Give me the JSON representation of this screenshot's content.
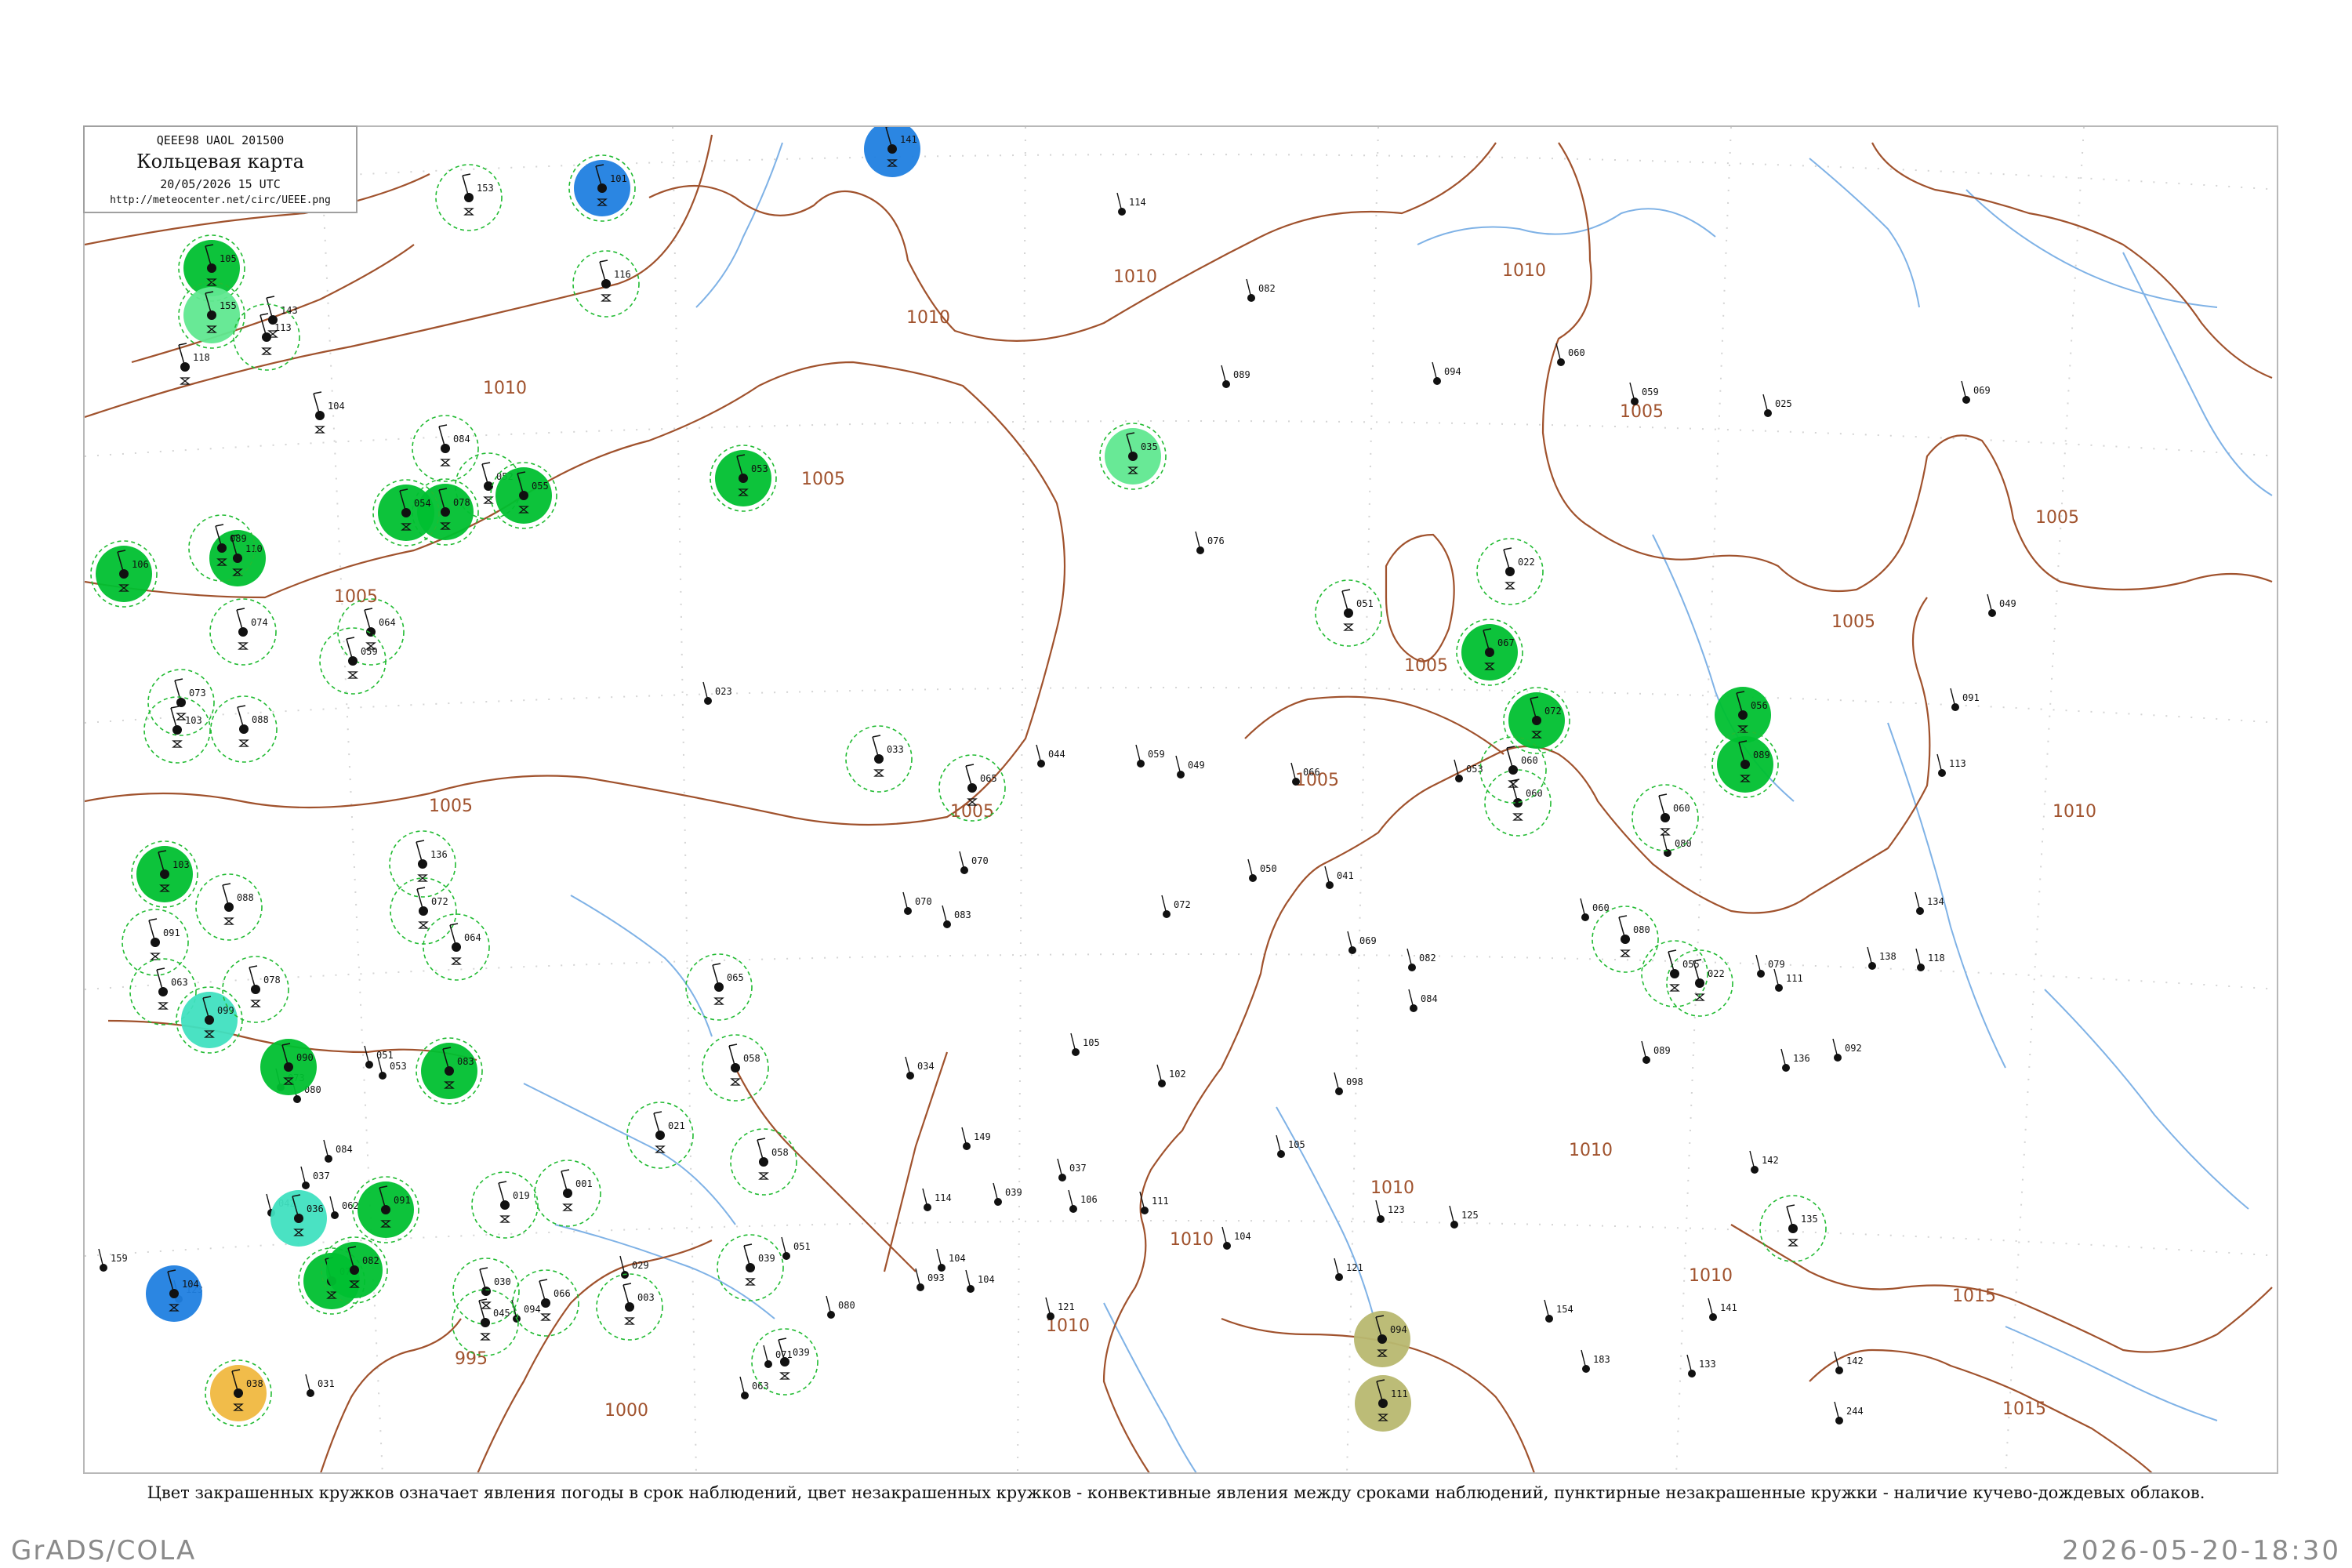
{
  "legend": {
    "code": "QEEE98  UAOL  201500",
    "title": "Кольцевая карта",
    "date": "20/05/2026 15 UTC",
    "url": "http://meteocenter.net/circ/UEEE.png"
  },
  "caption": "Цвет закрашенных кружков означает явления погоды в срок наблюдений, цвет незакрашенных кружков - конвективные явления между сроками наблюдений, пунктирные незакрашенные кружки - наличие кучево-дождевых облаков.",
  "footer": {
    "left": "GrADS/COLA",
    "right": "2026-05-20-18:30"
  },
  "colors": {
    "isobar": "#a0522d",
    "water": "#7fb2e6",
    "rain": "#00c030",
    "showers": "#2080e0",
    "drizzle": "#60e890",
    "fog": "#40e0c0",
    "haze": "#b8b870",
    "dust": "#f0b840",
    "cb_ring": "#22bb33"
  },
  "isobar_labels": [
    {
      "text": "1010"
    },
    {
      "text": "1010"
    },
    {
      "text": "1010"
    },
    {
      "text": "1005"
    },
    {
      "text": "1005"
    },
    {
      "text": "1005"
    },
    {
      "text": "1005"
    },
    {
      "text": "1005"
    },
    {
      "text": "1005"
    },
    {
      "text": "1005"
    },
    {
      "text": "1005"
    },
    {
      "text": "1005"
    },
    {
      "text": "1010"
    },
    {
      "text": "1010"
    },
    {
      "text": "1010"
    },
    {
      "text": "1010"
    },
    {
      "text": "1010"
    },
    {
      "text": "1010"
    },
    {
      "text": "1010"
    },
    {
      "text": "1015"
    },
    {
      "text": "1015"
    },
    {
      "text": "995"
    },
    {
      "text": "1000"
    }
  ],
  "stations": [
    {
      "w": "none",
      "cb": true,
      "num": "153"
    },
    {
      "w": "rain",
      "cb": true,
      "num": "105"
    },
    {
      "w": "showers",
      "cb": true,
      "num": "101"
    },
    {
      "w": "showers",
      "cb": false,
      "num": "141"
    },
    {
      "w": "drizzle",
      "cb": true,
      "num": "155"
    },
    {
      "w": "none",
      "cb": true,
      "num": "116"
    },
    {
      "w": "none",
      "cb": false,
      "num": "143"
    },
    {
      "w": "none",
      "cb": true,
      "num": "113"
    },
    {
      "w": "none",
      "cb": false,
      "num": "118"
    },
    {
      "w": "none",
      "cb": false,
      "num": "104"
    },
    {
      "w": "none",
      "cb": true,
      "num": "084"
    },
    {
      "w": "none",
      "cb": true,
      "num": "052"
    },
    {
      "w": "rain",
      "cb": true,
      "num": "053"
    },
    {
      "w": "rain",
      "cb": true,
      "num": "078"
    },
    {
      "w": "rain",
      "cb": true,
      "num": "055"
    },
    {
      "w": "rain",
      "cb": true,
      "num": "054"
    },
    {
      "w": "rain",
      "cb": false,
      "num": "110"
    },
    {
      "w": "rain",
      "cb": true,
      "num": "106"
    },
    {
      "w": "none",
      "cb": true,
      "num": "089"
    },
    {
      "w": "none",
      "cb": true,
      "num": "074"
    },
    {
      "w": "none",
      "cb": true,
      "num": "064"
    },
    {
      "w": "none",
      "cb": true,
      "num": "073"
    },
    {
      "w": "none",
      "cb": true,
      "num": "088"
    },
    {
      "w": "none",
      "cb": true,
      "num": "059"
    },
    {
      "w": "none",
      "cb": true,
      "num": "103"
    },
    {
      "w": "none",
      "cb": true,
      "num": "033"
    },
    {
      "w": "drizzle",
      "cb": true,
      "num": "035"
    },
    {
      "w": "none",
      "cb": true,
      "num": "022"
    },
    {
      "w": "none",
      "cb": true,
      "num": "051"
    },
    {
      "w": "rain",
      "cb": true,
      "num": "067"
    },
    {
      "w": "rain",
      "cb": true,
      "num": "072"
    },
    {
      "w": "none",
      "cb": true,
      "num": "060"
    },
    {
      "w": "none",
      "cb": true,
      "num": "065"
    },
    {
      "w": "none",
      "cb": true,
      "num": "136"
    },
    {
      "w": "none",
      "cb": true,
      "num": "072"
    },
    {
      "w": "none",
      "cb": true,
      "num": "064"
    },
    {
      "w": "rain",
      "cb": true,
      "num": "103"
    },
    {
      "w": "none",
      "cb": true,
      "num": "088"
    },
    {
      "w": "none",
      "cb": true,
      "num": "091"
    },
    {
      "w": "none",
      "cb": true,
      "num": "063"
    },
    {
      "w": "fog",
      "cb": true,
      "num": "099"
    },
    {
      "w": "none",
      "cb": true,
      "num": "078"
    },
    {
      "w": "rain",
      "cb": false,
      "num": "090"
    },
    {
      "w": "rain",
      "cb": true,
      "num": "083"
    },
    {
      "w": "fog",
      "cb": false,
      "num": "036"
    },
    {
      "w": "rain",
      "cb": true,
      "num": "091"
    },
    {
      "w": "showers",
      "cb": false,
      "num": "104"
    },
    {
      "w": "rain",
      "cb": true,
      "num": "079"
    },
    {
      "w": "rain",
      "cb": true,
      "num": "082"
    },
    {
      "w": "dust",
      "cb": true,
      "num": "038"
    },
    {
      "w": "none",
      "cb": true,
      "num": "065"
    },
    {
      "w": "none",
      "cb": true,
      "num": "058"
    },
    {
      "w": "none",
      "cb": true,
      "num": "058"
    },
    {
      "w": "none",
      "cb": true,
      "num": "019"
    },
    {
      "w": "none",
      "cb": true,
      "num": "021"
    },
    {
      "w": "none",
      "cb": true,
      "num": "001"
    },
    {
      "w": "none",
      "cb": true,
      "num": "030"
    },
    {
      "w": "none",
      "cb": true,
      "num": "066"
    },
    {
      "w": "none",
      "cb": true,
      "num": "045"
    },
    {
      "w": "none",
      "cb": true,
      "num": "003"
    },
    {
      "w": "none",
      "cb": true,
      "num": "039"
    },
    {
      "w": "none",
      "cb": true,
      "num": "039"
    },
    {
      "w": "none",
      "cb": true,
      "num": "060"
    },
    {
      "w": "none",
      "cb": true,
      "num": "060"
    },
    {
      "w": "none",
      "cb": true,
      "num": "080"
    },
    {
      "w": "none",
      "cb": true,
      "num": "022"
    },
    {
      "w": "none",
      "cb": true,
      "num": "135"
    },
    {
      "w": "rain",
      "cb": false,
      "num": "056"
    },
    {
      "w": "rain",
      "cb": true,
      "num": "089"
    },
    {
      "w": "haze",
      "cb": false,
      "num": "094"
    },
    {
      "w": "haze",
      "cb": false,
      "num": "111"
    },
    {
      "w": "none",
      "cb": true,
      "num": "055"
    }
  ],
  "plots": [
    {
      "num": "114"
    },
    {
      "num": "082"
    },
    {
      "num": "089"
    },
    {
      "num": "094"
    },
    {
      "num": "076"
    },
    {
      "num": "060"
    },
    {
      "num": "059"
    },
    {
      "num": "025"
    },
    {
      "num": "069"
    },
    {
      "num": "049"
    },
    {
      "num": "023"
    },
    {
      "num": "044"
    },
    {
      "num": "059"
    },
    {
      "num": "049"
    },
    {
      "num": "066"
    },
    {
      "num": "053"
    },
    {
      "num": "091"
    },
    {
      "num": "113"
    },
    {
      "num": "070"
    },
    {
      "num": "080"
    },
    {
      "num": "050"
    },
    {
      "num": "041"
    },
    {
      "num": "070"
    },
    {
      "num": "083"
    },
    {
      "num": "072"
    },
    {
      "num": "060"
    },
    {
      "num": "082"
    },
    {
      "num": "069"
    },
    {
      "num": "084"
    },
    {
      "num": "134"
    },
    {
      "num": "118"
    },
    {
      "num": "138"
    },
    {
      "num": "111"
    },
    {
      "num": "136"
    },
    {
      "num": "142"
    },
    {
      "num": "105"
    },
    {
      "num": "102"
    },
    {
      "num": "098"
    },
    {
      "num": "105"
    },
    {
      "num": "106"
    },
    {
      "num": "111"
    },
    {
      "num": "104"
    },
    {
      "num": "121"
    },
    {
      "num": "123"
    },
    {
      "num": "125"
    },
    {
      "num": "154"
    },
    {
      "num": "141"
    },
    {
      "num": "183"
    },
    {
      "num": "133"
    },
    {
      "num": "142"
    },
    {
      "num": "244"
    },
    {
      "num": "104"
    },
    {
      "num": "093"
    },
    {
      "num": "080"
    },
    {
      "num": "104"
    },
    {
      "num": "121"
    },
    {
      "num": "114"
    },
    {
      "num": "051"
    },
    {
      "num": "071"
    },
    {
      "num": "063"
    },
    {
      "num": "029"
    },
    {
      "num": "094"
    },
    {
      "num": "123"
    },
    {
      "num": "159"
    },
    {
      "num": "031"
    },
    {
      "num": "042"
    },
    {
      "num": "037"
    },
    {
      "num": "062"
    },
    {
      "num": "084"
    },
    {
      "num": "080"
    },
    {
      "num": "073"
    },
    {
      "num": "051"
    },
    {
      "num": "053"
    },
    {
      "num": "034"
    },
    {
      "num": "149"
    },
    {
      "num": "039"
    },
    {
      "num": "037"
    },
    {
      "num": "079"
    },
    {
      "num": "089"
    },
    {
      "num": "092"
    }
  ]
}
